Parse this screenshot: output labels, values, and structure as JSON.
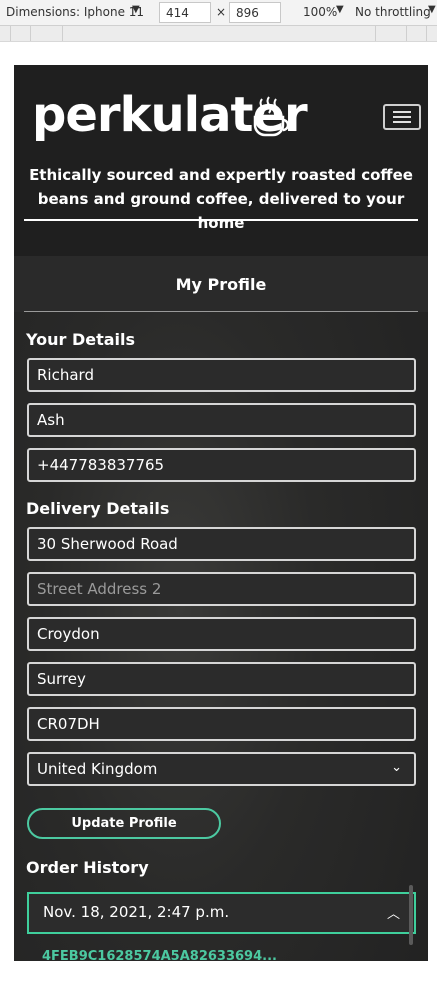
{
  "devtools": {
    "dimensions_label": "Dimensions: Iphone 11",
    "width_value": "414",
    "times": "×",
    "height_value": "896",
    "zoom": "100%",
    "throttling": "No throttling"
  },
  "site": {
    "logo_text": "perkulater",
    "tagline": "Ethically sourced and expertly roasted coffee beans and ground coffee, delivered to your home"
  },
  "profile": {
    "title": "My Profile",
    "your_details_heading": "Your Details",
    "first_name": "Richard",
    "last_name": "Ash",
    "phone": "+447783837765",
    "delivery_heading": "Delivery Details",
    "street1": "30 Sherwood Road",
    "street2_placeholder": "Street Address 2",
    "town": "Croydon",
    "county": "Surrey",
    "postcode": "CR07DH",
    "country": "United Kingdom",
    "update_button": "Update Profile",
    "order_history_heading": "Order History",
    "order_date": "Nov. 18, 2021, 2:47 p.m.",
    "order_number": "4FEB9C1628574A5A82633694..."
  },
  "colors": {
    "accent": "#4cc9a1",
    "background": "#222222"
  }
}
